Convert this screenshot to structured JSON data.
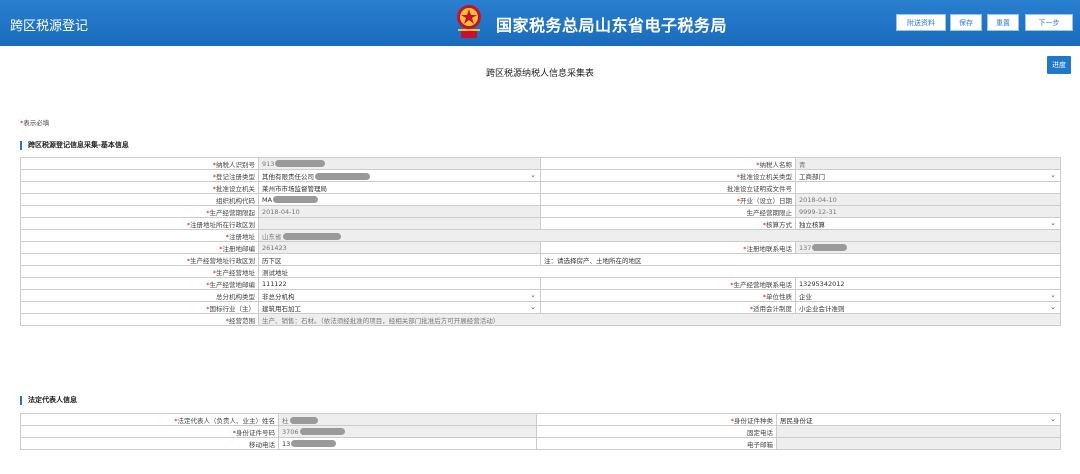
{
  "header": {
    "app_title": "跨区税源登记",
    "site_title": "国家税务总局山东省电子税务局",
    "buttons": [
      "附送资料",
      "保存",
      "重置",
      "下一步"
    ],
    "colors": {
      "bar": "#1a6bbd",
      "accent": "#1f78c9"
    }
  },
  "form_title": "跨区税源纳税人信息采集表",
  "progress_label": "进度",
  "required_note": {
    "star": "*",
    "text": "表示必填"
  },
  "sections": {
    "basic": "跨区税源登记信息采集-基本信息",
    "legal": "法定代表人信息"
  },
  "basic_rows": [
    {
      "l1": "纳税人识别号",
      "r1": true,
      "v1": "913",
      "ro1": true,
      "l2": "纳税人名称",
      "r2": true,
      "v2": "青",
      "ro2": true
    },
    {
      "l1": "登记注册类型",
      "r1": true,
      "v1": "其他有限责任公司",
      "sel1": true,
      "l2": "批准设立机关类型",
      "r2": true,
      "v2": "工商部门",
      "sel2": true
    },
    {
      "l1": "批准设立机关",
      "r1": true,
      "v1": "莱州市市场监督管理局",
      "l2": "批准设立证明或文件号",
      "r2": false,
      "v2": ""
    },
    {
      "l1": "组织机构代码",
      "r1": false,
      "v1": "MA",
      "l2": "开业（设立）日期",
      "r2": true,
      "v2": "2018-04-10",
      "ro2": true
    },
    {
      "l1": "生产经营期限起",
      "r1": true,
      "v1": "2018-04-10",
      "ro1": true,
      "l2": "生产经营期限止",
      "r2": false,
      "v2": "9999-12-31",
      "ro2": true
    },
    {
      "l1": "注册地址所在行政区划",
      "r1": true,
      "v1": "",
      "ro1": true,
      "l2": "核算方式",
      "r2": true,
      "v2": "独立核算",
      "sel2": true
    },
    {
      "full": true,
      "l1": "注册地址",
      "r1": true,
      "v1": "山东省",
      "ro1": true
    },
    {
      "l1": "注册地邮编",
      "r1": true,
      "v1": "261423",
      "ro1": true,
      "l2": "注册地联系电话",
      "r2": true,
      "v2": "137",
      "ro2": true
    },
    {
      "l1": "生产经营地址行政区划",
      "r1": true,
      "v1": "历下区",
      "l2": "注：请选择房产、土地所在的地区",
      "note": true
    },
    {
      "full": true,
      "l1": "生产经营地址",
      "r1": true,
      "v1": "测试地址"
    },
    {
      "l1": "生产经营地邮编",
      "r1": true,
      "v1": "111122",
      "l2": "生产经营地联系电话",
      "r2": true,
      "v2": "13295342012"
    },
    {
      "l1": "总分机构类型",
      "r1": false,
      "v1": "非总分机构",
      "sel1": true,
      "l2": "单位性质",
      "r2": true,
      "v2": "企业",
      "sel2": true
    },
    {
      "l1": "国标行业（主）",
      "r1": true,
      "v1": "建筑用石加工",
      "sel1": true,
      "l2": "适用会计制度",
      "r2": true,
      "v2": "小企业会计准则",
      "sel2": true
    },
    {
      "full": true,
      "l1": "经营范围",
      "r1": true,
      "v1": "生产、销售：石材。（依法须经批准的项目，经相关部门批准后方可开展经营活动）",
      "ro1": true
    }
  ],
  "legal_rows": [
    {
      "l1": "法定代表人（负责人、业主）姓名",
      "r1": true,
      "v1": "杜",
      "ro1": true,
      "l2": "身份证件种类",
      "r2": true,
      "v2": "居民身份证",
      "sel2": true
    },
    {
      "l1": "身份证件号码",
      "r1": true,
      "v1": "3706",
      "ro1": true,
      "l2": "固定电话",
      "r2": false,
      "v2": "",
      "ro2": true
    },
    {
      "l1": "移动电话",
      "r1": false,
      "v1": "13",
      "l2": "电子邮箱",
      "r2": false,
      "v2": "",
      "ro2": true
    }
  ],
  "masks": {
    "basic": [
      [
        50,
        0
      ],
      [
        55,
        0
      ],
      [
        0,
        0
      ],
      [
        45,
        0
      ],
      [
        0,
        0
      ],
      [
        0,
        0
      ],
      [
        58,
        0
      ],
      [
        0,
        35
      ],
      [
        0,
        0
      ],
      [
        0,
        0
      ],
      [
        0,
        0
      ],
      [
        0,
        0
      ],
      [
        0,
        0
      ],
      [
        0,
        0
      ]
    ],
    "legal": [
      [
        28,
        0
      ],
      [
        45,
        0
      ],
      [
        45,
        0
      ]
    ]
  }
}
